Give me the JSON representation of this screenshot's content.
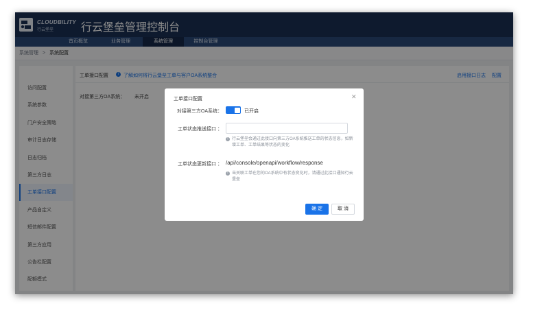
{
  "brand": {
    "name_en": "CLOUDBILITY",
    "name_cn": "行云堡垒"
  },
  "header": {
    "title": "行云堡垒管理控制台"
  },
  "nav": {
    "items": [
      {
        "label": "首页概览"
      },
      {
        "label": "业务管理"
      },
      {
        "label": "系统管理"
      },
      {
        "label": "控制台管理"
      }
    ],
    "active": "系统管理"
  },
  "breadcrumb": {
    "parent": "系统管理",
    "separator": ">",
    "current": "系统配置"
  },
  "sidebar": {
    "items": [
      {
        "label": "访问配置"
      },
      {
        "label": "系统参数"
      },
      {
        "label": "门户安全策略"
      },
      {
        "label": "审计日志存储"
      },
      {
        "label": "日志归档"
      },
      {
        "label": "第三方日志"
      },
      {
        "label": "工单接口配置"
      },
      {
        "label": "产品自定义"
      },
      {
        "label": "短信邮件配置"
      },
      {
        "label": "第三方应用"
      },
      {
        "label": "公告栏配置"
      },
      {
        "label": "配额模式"
      }
    ],
    "active": "工单接口配置"
  },
  "main": {
    "title": "工单接口配置",
    "info_icon": "info-icon",
    "info_link": "了解如何将行云堡垒工单与客户OA系统整合",
    "enable_log": "启用接口日志",
    "config_link": "配置",
    "oa_label": "对接第三方OA系统：",
    "oa_value": "未开启"
  },
  "modal": {
    "title": "工单接口配置",
    "close_icon": "close-icon",
    "oa_label": "对接第三方OA系统：",
    "oa_enabled": true,
    "oa_status": "已开启",
    "push_label": "工单状态推送接口 ：",
    "push_value": "",
    "push_placeholder": "",
    "push_hint": "行云堡垒会通过此接口向第三方OA系统推送工单的状态信息，如新增工单、工单结果等状态的变化",
    "update_label": "工单状态更新接口 ：",
    "update_value": "/api/console/openapi/workflow/response",
    "update_hint": "当关联工单在您的OA系统中有状态变化时，请通过此接口通知行云堡垒",
    "ok_label": "确 定",
    "cancel_label": "取 消"
  },
  "colors": {
    "primary": "#1a73e8",
    "header_bg": "#1a3154",
    "nav_bg": "#2a4a78"
  }
}
